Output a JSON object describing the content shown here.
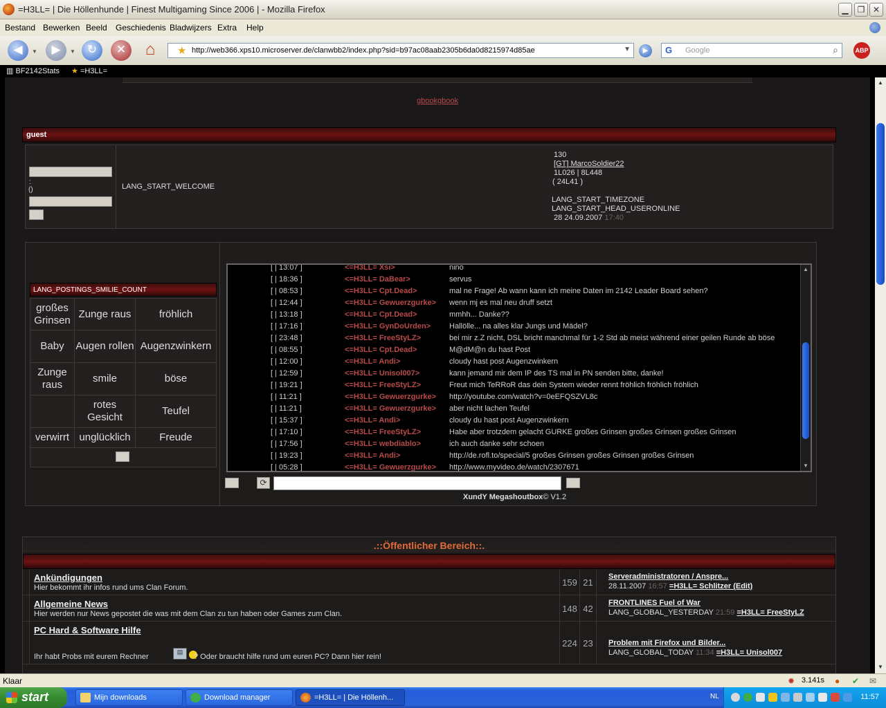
{
  "window": {
    "title": "=H3LL= | Die Höllenhunde | Finest Multigaming Since 2006 | - Mozilla Firefox"
  },
  "menu": [
    "Bestand",
    "Bewerken",
    "Beeld",
    "Geschiedenis",
    "Bladwijzers",
    "Extra",
    "Help"
  ],
  "nav": {
    "url": "http://web366.xps10.microserver.de/clanwbb2/index.php?sid=b97ac08aab2305b6da0d8215974d85ae",
    "search_placeholder": "Google",
    "abp": "ABP"
  },
  "bookmarks": [
    "BF2142Stats",
    "=H3LL="
  ],
  "page": {
    "gbook_link": "gbookgbook",
    "guest_label": "guest",
    "login": {
      "sep1": ":",
      "sep2": "()"
    },
    "welcome": "LANG_START_WELCOME",
    "stats": {
      "count": "130",
      "newest_user": "[GT] MarcoSoldier22",
      "line3": "1L026 | 8L448",
      "line4": "( 24L41 )",
      "timezone": "LANG_START_TIMEZONE",
      "useronline": "LANG_START_HEAD_USERONLINE",
      "date": "28 24.09.2007",
      "time": "17:40"
    },
    "smilies": {
      "header": "LANG_POSTINGS_SMILIE_COUNT",
      "rows": [
        [
          "großes Grinsen",
          "Zunge raus",
          "fröhlich"
        ],
        [
          "Baby",
          "Augen rollen",
          "Augenzwinkern"
        ],
        [
          "Zunge raus",
          "smile",
          "böse"
        ],
        [
          "",
          "rotes Gesicht",
          "Teufel"
        ],
        [
          "verwirrt",
          "unglücklich",
          "Freude"
        ]
      ]
    },
    "shouts": [
      {
        "time": "[ | 13:07 ]",
        "user": "<=H3LL= Xsi>",
        "msg": "nino"
      },
      {
        "time": "[ | 18:36 ]",
        "user": "<=H3LL= DaBear>",
        "msg": "servus"
      },
      {
        "time": "[ | 08:53 ]",
        "user": "<=H3LL= Cpt.Dead>",
        "msg": "mal ne Frage! Ab wann kann ich meine Daten im 2142 Leader Board sehen?"
      },
      {
        "time": "[ | 12:44 ]",
        "user": "<=H3LL= Gewuerzgurke>",
        "msg": "wenn mj es mal neu druff setzt"
      },
      {
        "time": "[ | 13:18 ]",
        "user": "<=H3LL= Cpt.Dead>",
        "msg": "mmhh... Danke??"
      },
      {
        "time": "[ | 17:16 ]",
        "user": "<=H3LL= GynDoUrden>",
        "msg": "Hallölle... na alles klar Jungs und Mädel?"
      },
      {
        "time": "[ | 23:48 ]",
        "user": "<=H3LL= FreeStyLZ>",
        "msg": "bei mir z.Z nicht, DSL bricht manchmal für 1-2 Std ab meist während einer geilen Runde ab böse"
      },
      {
        "time": "[ | 08:55 ]",
        "user": "<=H3LL= Cpt.Dead>",
        "msg": "M@dM@n du hast Post"
      },
      {
        "time": "[ | 12:00 ]",
        "user": "<=H3LL= Andi>",
        "msg": "cloudy hast post Augenzwinkern"
      },
      {
        "time": "[ | 12:59 ]",
        "user": "<=H3LL= Unisol007>",
        "msg": "kann jemand mir dem IP des TS mal in PN senden bitte, danke!"
      },
      {
        "time": "[ | 19:21 ]",
        "user": "<=H3LL= FreeStyLZ>",
        "msg": "Freut mich TeRRoR das dein System wieder rennt fröhlich fröhlich fröhlich"
      },
      {
        "time": "[ | 11:21 ]",
        "user": "<=H3LL= Gewuerzgurke>",
        "msg": "http://youtube.com/watch?v=0eEFQSZVL8c"
      },
      {
        "time": "[ | 11:21 ]",
        "user": "<=H3LL= Gewuerzgurke>",
        "msg": "aber nicht lachen Teufel"
      },
      {
        "time": "[ | 15:37 ]",
        "user": "<=H3LL= Andi>",
        "msg": "cloudy du hast post Augenzwinkern"
      },
      {
        "time": "[ | 17:10 ]",
        "user": "<=H3LL= FreeStyLZ>",
        "msg": "Habe aber trotzdem gelacht GURKE großes Grinsen großes Grinsen großes Grinsen"
      },
      {
        "time": "[ | 17:56 ]",
        "user": "<=H3LL= webdiablo>",
        "msg": "ich auch danke sehr schoen"
      },
      {
        "time": "[ | 19:23 ]",
        "user": "<=H3LL= Andi>",
        "msg": "http://de.rofl.to/special/5 großes Grinsen großes Grinsen großes Grinsen"
      },
      {
        "time": "[ | 05:28 ]",
        "user": "<=H3LL= Gewuerzgurke>",
        "msg": "http://www.myvideo.de/watch/2307671"
      }
    ],
    "shout_credit_name": "XundY Megashoutbox",
    "shout_credit_ver": "© V1.2",
    "public_header": ".::Öffentlicher Bereich::.",
    "forums": [
      {
        "title": "Ankündigungen",
        "desc": "Hier bekommt ihr infos rund ums Clan Forum.",
        "posts": "159",
        "threads": "21",
        "last_title": "Serveradministratoren / Anspre...",
        "last_date": "28.11.2007",
        "last_time": "16:57",
        "last_user": "=H3LL= Schlitzer (Edit)"
      },
      {
        "title": "Allgemeine News",
        "desc": "Hier werden nur News gepostet die was mit dem Clan zu tun haben oder Games zum Clan.",
        "posts": "148",
        "threads": "42",
        "last_title": "FRONTLINES Fuel of War",
        "last_date": "LANG_GLOBAL_YESTERDAY",
        "last_time": "21:59",
        "last_user": "=H3LL= FreeStyLZ"
      },
      {
        "title": "PC Hard & Software Hilfe",
        "desc_a": "Ihr habt Probs mit eurem Rechner",
        "desc_b": "? Oder braucht hilfe rund um euren PC? Dann hier rein!",
        "posts": "224",
        "threads": "23",
        "last_title": "Problem mit Firefox und Bilder...",
        "last_date": "LANG_GLOBAL_TODAY",
        "last_time": "11:34",
        "last_user": "=H3LL= Unisol007"
      }
    ]
  },
  "status": {
    "text": "Klaar",
    "timer": "3.141s"
  },
  "taskbar": {
    "start": "start",
    "tasks": [
      "Mijn downloads",
      "Download manager",
      "=H3LL= | Die Höllenh..."
    ],
    "lang": "NL",
    "clock": "11:57"
  }
}
